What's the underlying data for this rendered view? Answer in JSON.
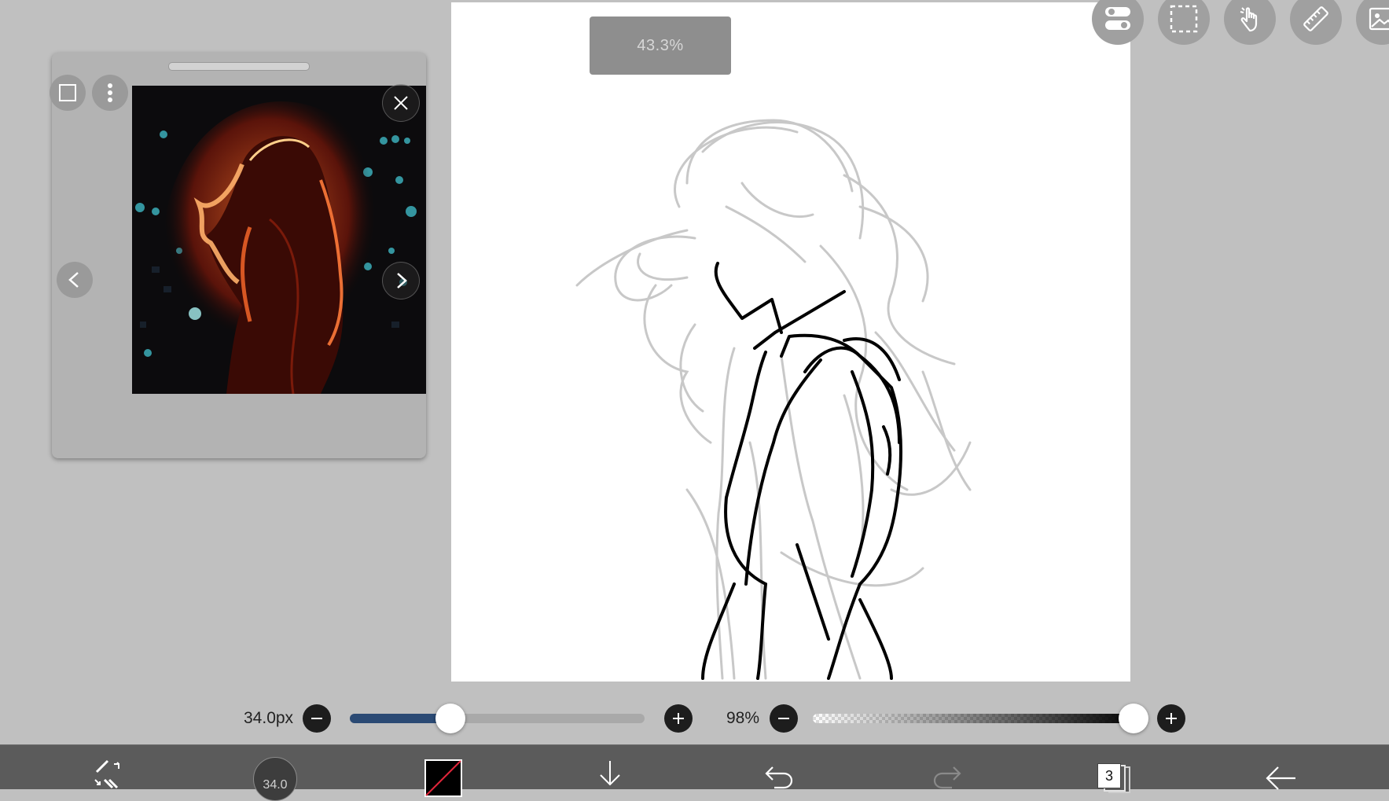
{
  "canvas": {
    "zoom_label": "43.3%"
  },
  "toolbar_top": {
    "icons": [
      "layers-toggle-icon",
      "selection-icon",
      "hand-icon",
      "ruler-icon",
      "image-icon"
    ]
  },
  "reference_window": {
    "icons": [
      "square-frame-icon",
      "more-vert-icon",
      "close-icon",
      "chevron-left-icon",
      "chevron-right-icon"
    ]
  },
  "brush_size": {
    "label": "34.0px",
    "value_fraction": 0.34
  },
  "opacity": {
    "label": "98%",
    "value_fraction": 0.98
  },
  "bottom_bar": {
    "brush_size_badge": "34.0",
    "layer_count": "3",
    "icons": [
      "brush-eraser-switch-icon",
      "brush-size-icon",
      "color-icon",
      "download-icon",
      "undo-icon",
      "redo-icon",
      "layers-icon",
      "back-icon"
    ],
    "colors": {
      "primary": "#000000",
      "accent": "#2b4a74"
    }
  }
}
